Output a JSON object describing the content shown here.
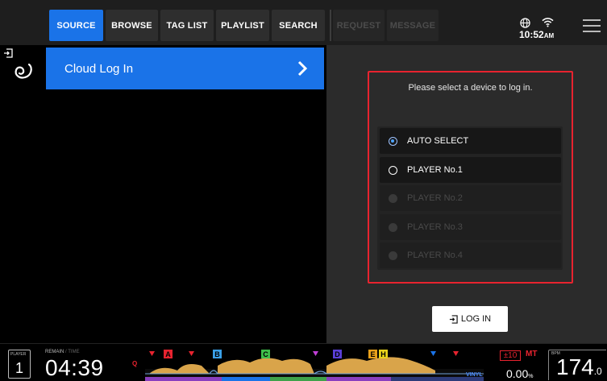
{
  "tabs": [
    {
      "label": "SOURCE",
      "state": "active"
    },
    {
      "label": "BROWSE",
      "state": "normal"
    },
    {
      "label": "TAG LIST",
      "state": "normal"
    },
    {
      "label": "PLAYLIST",
      "state": "normal"
    },
    {
      "label": "SEARCH",
      "state": "normal"
    },
    {
      "label": "REQUEST",
      "state": "disabled"
    },
    {
      "label": "MESSAGE",
      "state": "disabled"
    }
  ],
  "status": {
    "time": "10:52",
    "ampm": "AM"
  },
  "source": {
    "item_label": "Cloud Log In"
  },
  "login_panel": {
    "prompt": "Please select a device to log in.",
    "options": [
      {
        "label": "AUTO SELECT",
        "state": "selected"
      },
      {
        "label": "PLAYER No.1",
        "state": "enabled"
      },
      {
        "label": "PLAYER No.2",
        "state": "disabled"
      },
      {
        "label": "PLAYER No.3",
        "state": "disabled"
      },
      {
        "label": "PLAYER No.4",
        "state": "disabled"
      }
    ],
    "button_label": "LOG IN"
  },
  "deck": {
    "player_label": "PLAYER",
    "player_number": "1",
    "remain_label": "REMAIN",
    "time_label": "TIME",
    "remain_time": "04:39",
    "cue_marker": "Q",
    "hot_cues": [
      "A",
      "B",
      "C",
      "D",
      "E",
      "H"
    ],
    "vinyl_label": "VINYL",
    "tempo_range": "±10",
    "master_tempo": "MT",
    "pitch": "0.00",
    "pitch_unit": "%",
    "bpm_label": "BPM",
    "bpm_int": "174",
    "bpm_dec": ".0"
  },
  "colors": {
    "accent": "#1a73e8",
    "highlight_border": "#e8232f",
    "panel_bg": "#2b2b2b",
    "waveform": "#d9a44a"
  }
}
